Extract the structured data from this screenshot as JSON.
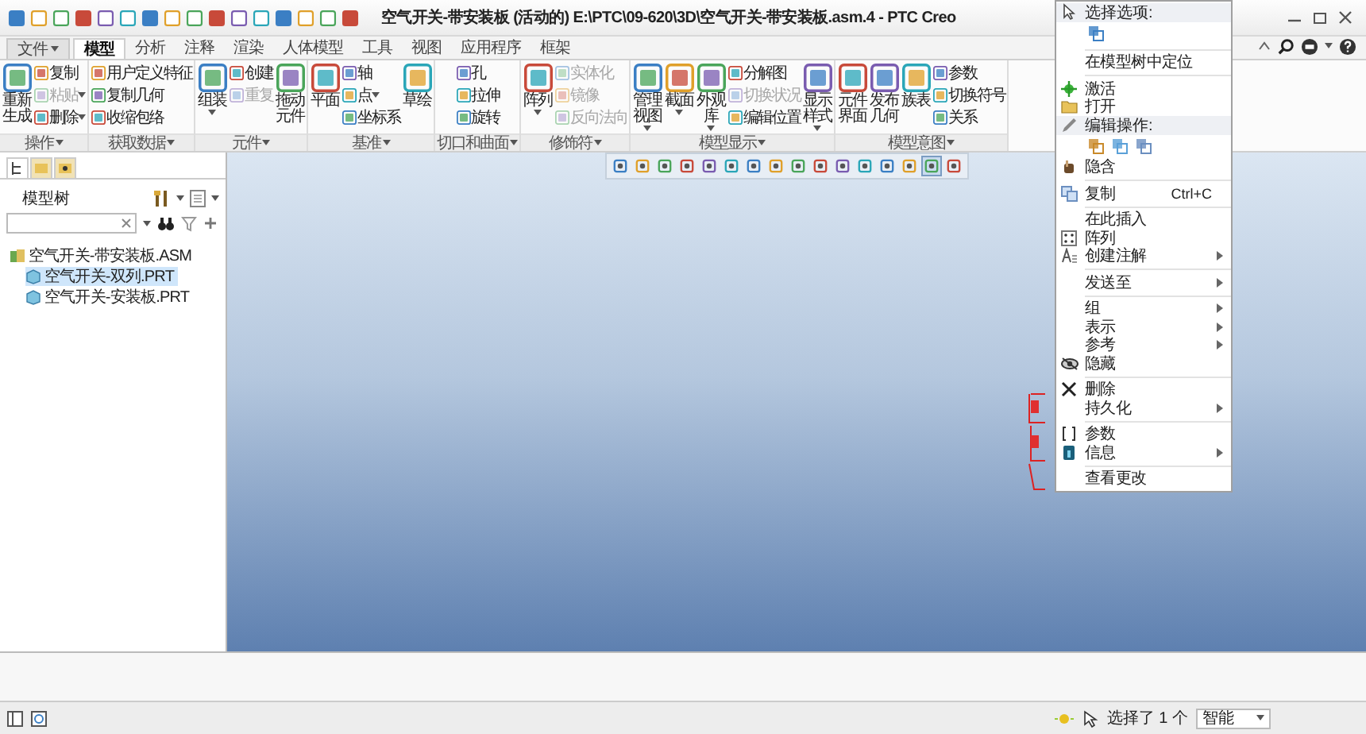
{
  "title_bar": {
    "title": "空气开关-带安装板 (活动的) E:\\PTC\\09-620\\3D\\空气开关-带安装板.asm.4 - PTC Creo"
  },
  "tabs": [
    {
      "label": "文件",
      "kind": "file",
      "selected": false
    },
    {
      "label": "模型",
      "kind": "tab",
      "selected": true
    },
    {
      "label": "分析",
      "kind": "tab",
      "selected": false
    },
    {
      "label": "注释",
      "kind": "tab",
      "selected": false
    },
    {
      "label": "渲染",
      "kind": "tab",
      "selected": false
    },
    {
      "label": "人体模型",
      "kind": "tab",
      "selected": false
    },
    {
      "label": "工具",
      "kind": "tab",
      "selected": false
    },
    {
      "label": "视图",
      "kind": "tab",
      "selected": false
    },
    {
      "label": "应用程序",
      "kind": "tab",
      "selected": false
    },
    {
      "label": "框架",
      "kind": "tab",
      "selected": false
    }
  ],
  "ribbon": [
    {
      "label": "操作",
      "columns": [
        {
          "kind": "large",
          "label": "重新生成",
          "caret": false
        },
        {
          "kind": "stack",
          "items": [
            {
              "label": "复制",
              "disabled": false,
              "caret": false
            },
            {
              "label": "粘贴",
              "disabled": true,
              "caret": true
            },
            {
              "label": "删除",
              "disabled": false,
              "caret": true
            }
          ]
        }
      ]
    },
    {
      "label": "获取数据",
      "columns": [
        {
          "kind": "stack",
          "items": [
            {
              "label": "用户定义特征",
              "disabled": false,
              "caret": false
            },
            {
              "label": "复制几何",
              "disabled": false,
              "caret": false
            },
            {
              "label": "收缩包络",
              "disabled": false,
              "caret": false
            }
          ]
        }
      ]
    },
    {
      "label": "元件",
      "columns": [
        {
          "kind": "large",
          "label": "组装",
          "caret": true
        },
        {
          "kind": "stack",
          "items": [
            {
              "label": "创建",
              "disabled": false,
              "caret": false
            },
            {
              "label": "重复",
              "disabled": true,
              "caret": false
            }
          ]
        },
        {
          "kind": "large",
          "label": "拖动元件",
          "caret": false
        }
      ]
    },
    {
      "label": "基准",
      "columns": [
        {
          "kind": "large",
          "label": "平面",
          "caret": false
        },
        {
          "kind": "stack",
          "items": [
            {
              "label": "轴",
              "disabled": false,
              "caret": false
            },
            {
              "label": "点",
              "disabled": false,
              "caret": true
            },
            {
              "label": "坐标系",
              "disabled": false,
              "caret": false
            }
          ]
        },
        {
          "kind": "large",
          "label": "草绘",
          "caret": false
        }
      ]
    },
    {
      "label": "切口和曲面",
      "columns": [
        {
          "kind": "stack",
          "items": [
            {
              "label": "孔",
              "disabled": false,
              "caret": false
            },
            {
              "label": "拉伸",
              "disabled": false,
              "caret": false
            },
            {
              "label": "旋转",
              "disabled": false,
              "caret": false
            }
          ]
        }
      ]
    },
    {
      "label": "修饰符",
      "columns": [
        {
          "kind": "large",
          "label": "阵列",
          "caret": true
        },
        {
          "kind": "stack",
          "items": [
            {
              "label": "实体化",
              "disabled": true,
              "caret": false
            },
            {
              "label": "镜像",
              "disabled": true,
              "caret": false
            },
            {
              "label": "反向法向",
              "disabled": true,
              "caret": false
            }
          ]
        }
      ]
    },
    {
      "label": "模型显示",
      "columns": [
        {
          "kind": "large",
          "label": "管理视图",
          "caret": true
        },
        {
          "kind": "large",
          "label": "截面",
          "caret": true
        },
        {
          "kind": "large",
          "label": "外观库",
          "caret": true
        },
        {
          "kind": "stack",
          "items": [
            {
              "label": "分解图",
              "disabled": false,
              "caret": false
            },
            {
              "label": "切换状况",
              "disabled": true,
              "caret": false
            },
            {
              "label": "编辑位置",
              "disabled": false,
              "caret": false
            }
          ]
        },
        {
          "kind": "large",
          "label": "显示样式",
          "caret": true
        }
      ]
    },
    {
      "label": "模型意图",
      "columns": [
        {
          "kind": "large",
          "label": "元件界面",
          "caret": false
        },
        {
          "kind": "large",
          "label": "发布几何",
          "caret": false
        },
        {
          "kind": "large",
          "label": "族表",
          "caret": false
        },
        {
          "kind": "stack",
          "items": [
            {
              "label": "参数",
              "disabled": false,
              "caret": false
            },
            {
              "label": "切换符号",
              "disabled": false,
              "caret": false
            },
            {
              "label": "关系",
              "disabled": false,
              "caret": false
            }
          ]
        }
      ]
    }
  ],
  "model_tree": {
    "tabs": [
      {
        "selected": true
      },
      {
        "selected": false
      },
      {
        "selected": false
      }
    ],
    "title": "模型树",
    "items": [
      {
        "label": "空气开关-带安装板.ASM",
        "selected": false,
        "children": [
          {
            "label": "空气开关-双列.PRT",
            "selected": true
          },
          {
            "label": "空气开关-安装板.PRT",
            "selected": false
          }
        ]
      }
    ]
  },
  "view_toolbar": [
    {
      "selected": false
    },
    {
      "selected": false
    },
    {
      "selected": false
    },
    {
      "selected": false
    },
    {
      "selected": false
    },
    {
      "selected": false
    },
    {
      "selected": false
    },
    {
      "selected": false
    },
    {
      "selected": false
    },
    {
      "selected": false
    },
    {
      "selected": false
    },
    {
      "selected": false
    },
    {
      "selected": false
    },
    {
      "selected": false
    },
    {
      "selected": true
    },
    {
      "selected": false
    }
  ],
  "context_menu": [
    {
      "kind": "header",
      "label": "选择选项:"
    },
    {
      "kind": "icons"
    },
    {
      "kind": "separator"
    },
    {
      "kind": "item",
      "label": "在模型树中定位",
      "submenu": false
    },
    {
      "kind": "separator"
    },
    {
      "kind": "item",
      "label": "激活",
      "submenu": false
    },
    {
      "kind": "item",
      "label": "打开",
      "submenu": false
    },
    {
      "kind": "header",
      "label": "编辑操作:"
    },
    {
      "kind": "icons"
    },
    {
      "kind": "item",
      "label": "隐含",
      "submenu": false
    },
    {
      "kind": "separator"
    },
    {
      "kind": "item",
      "label": "复制",
      "shortcut": "Ctrl+C",
      "submenu": false
    },
    {
      "kind": "separator"
    },
    {
      "kind": "item",
      "label": "在此插入",
      "submenu": false
    },
    {
      "kind": "item",
      "label": "阵列",
      "submenu": false
    },
    {
      "kind": "item",
      "label": "创建注解",
      "submenu": true
    },
    {
      "kind": "separator"
    },
    {
      "kind": "item",
      "label": "发送至",
      "submenu": true
    },
    {
      "kind": "separator"
    },
    {
      "kind": "item",
      "label": "组",
      "submenu": true
    },
    {
      "kind": "item",
      "label": "表示",
      "submenu": true
    },
    {
      "kind": "item",
      "label": "参考",
      "submenu": true
    },
    {
      "kind": "item",
      "label": "隐藏",
      "submenu": false
    },
    {
      "kind": "separator"
    },
    {
      "kind": "item",
      "label": "删除",
      "submenu": false
    },
    {
      "kind": "item",
      "label": "持久化",
      "submenu": true
    },
    {
      "kind": "separator"
    },
    {
      "kind": "item",
      "label": "参数",
      "submenu": false
    },
    {
      "kind": "item",
      "label": "信息",
      "submenu": true
    },
    {
      "kind": "separator"
    },
    {
      "kind": "item",
      "label": "查看更改",
      "submenu": false
    }
  ],
  "status_bar": {
    "selection": "选择了 1 个",
    "filter": "智能"
  }
}
